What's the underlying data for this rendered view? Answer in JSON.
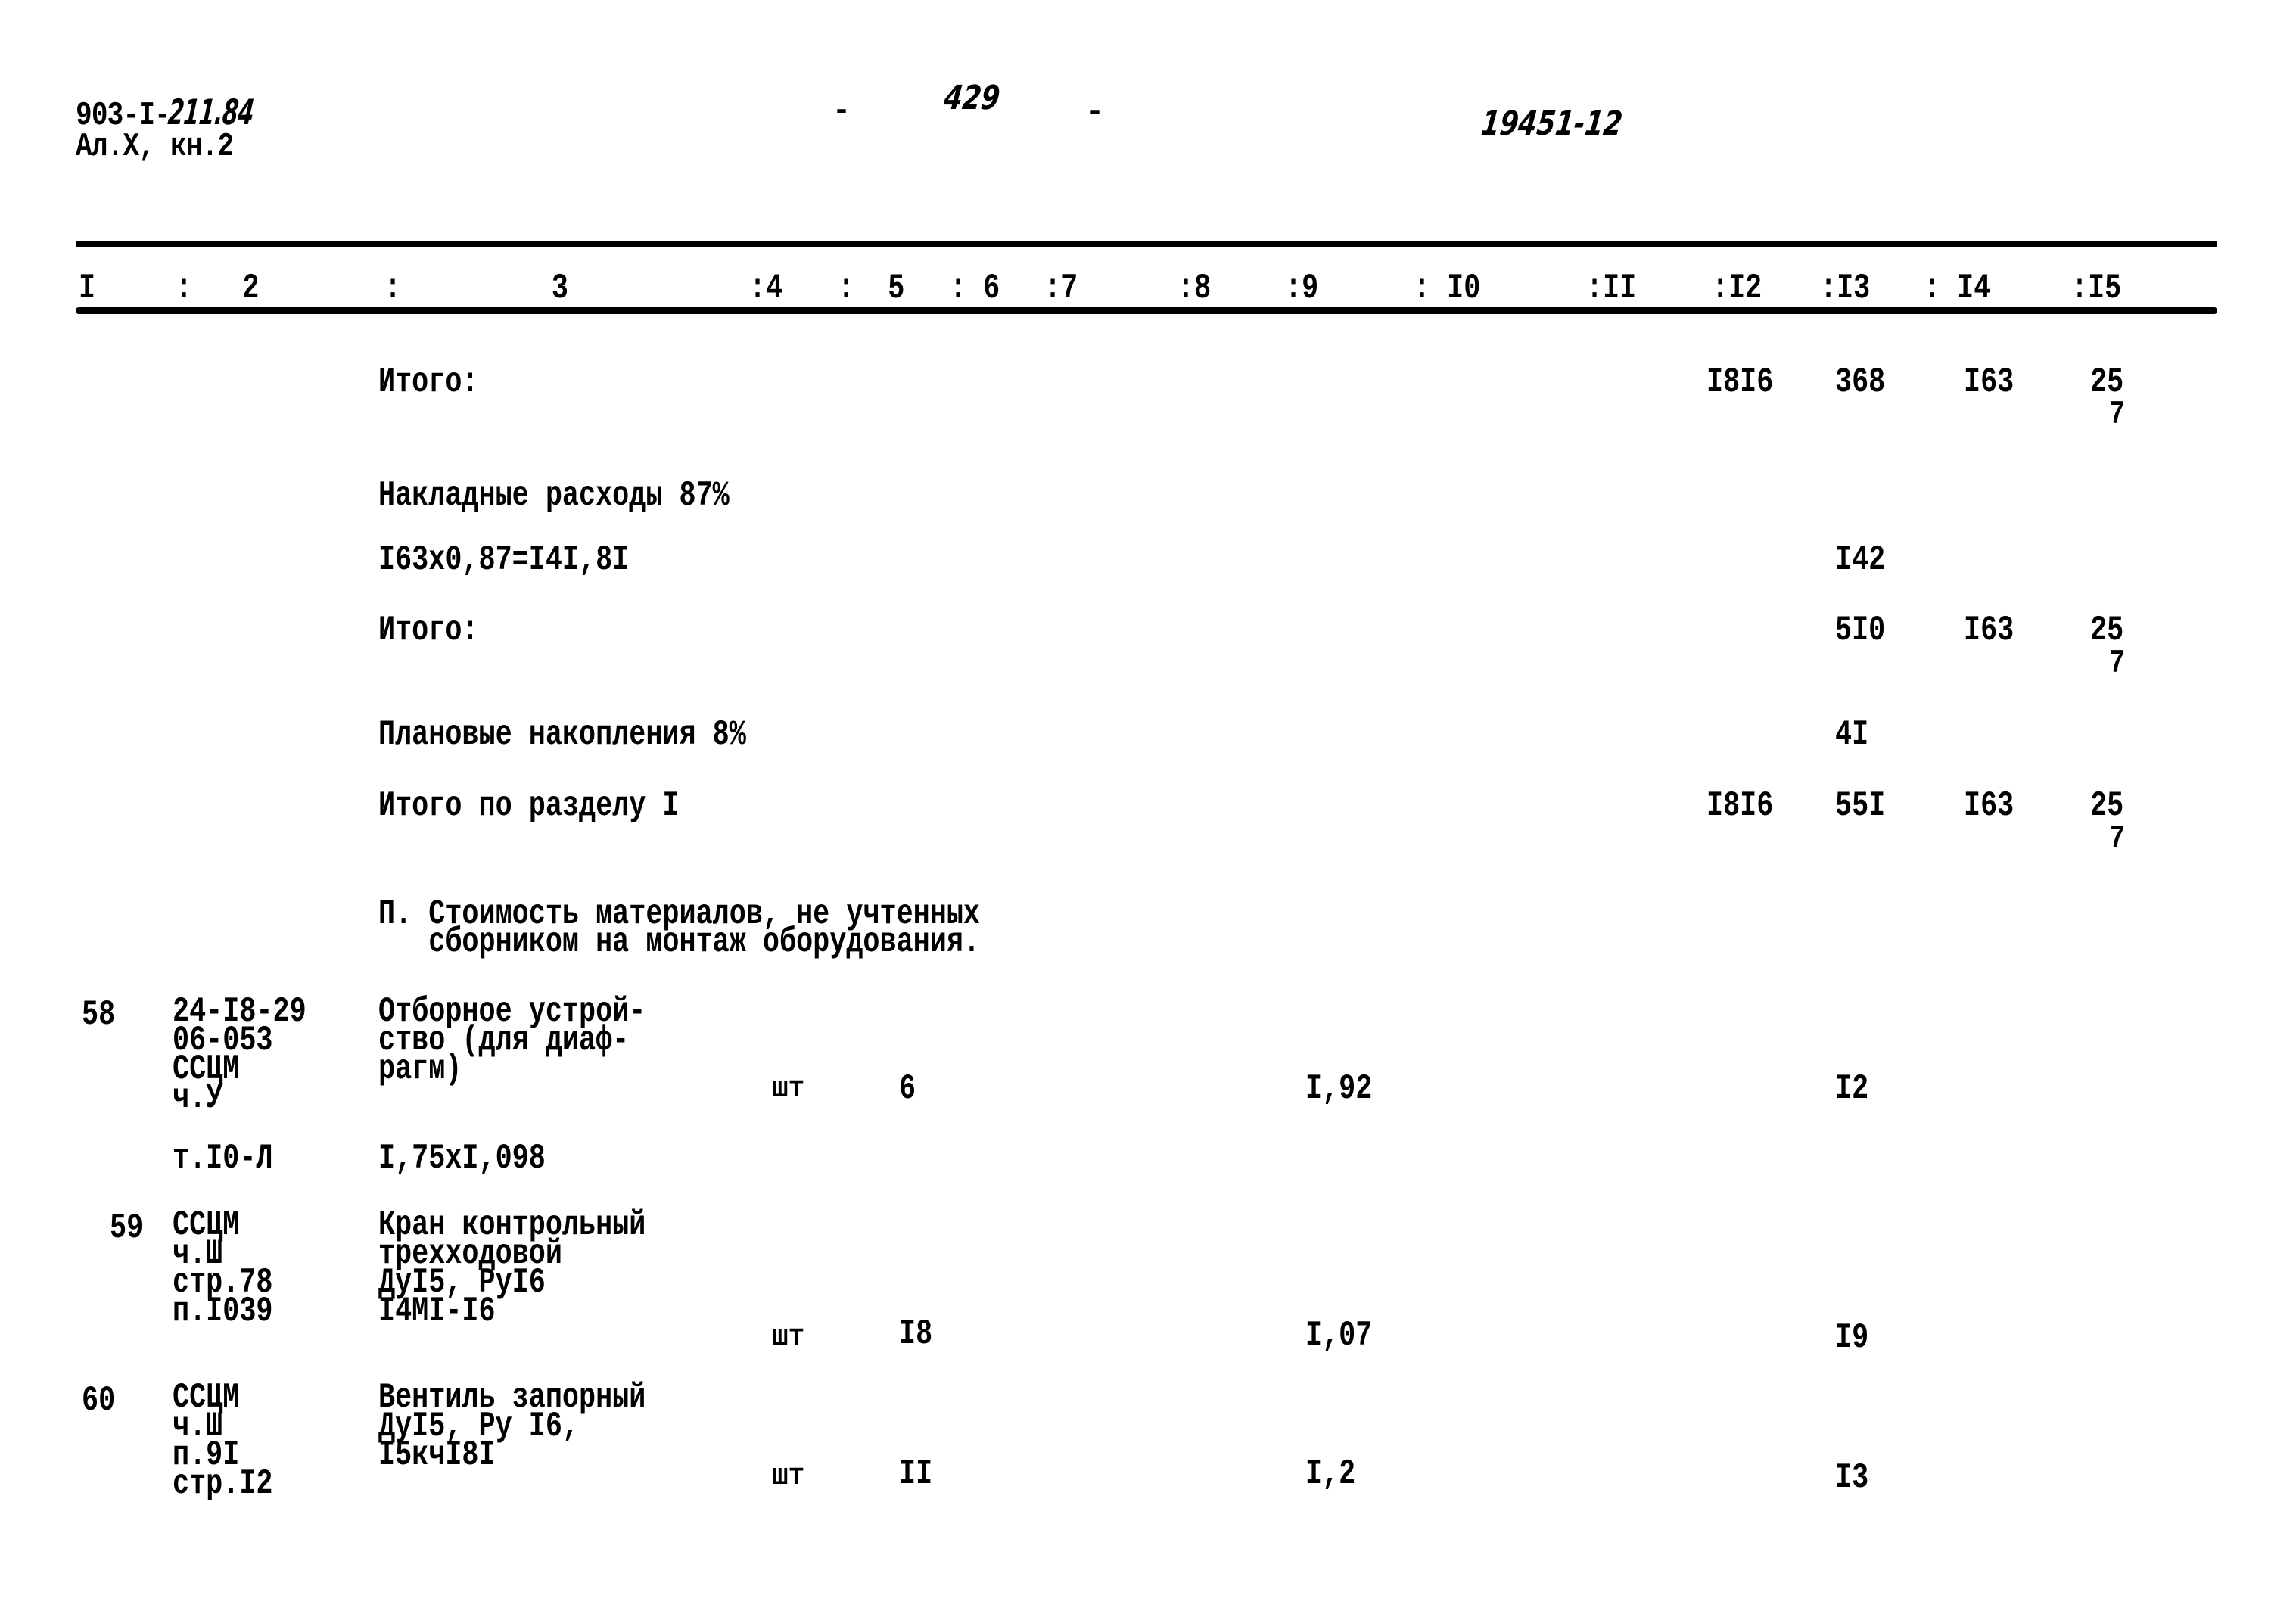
{
  "header": {
    "doc_code_prefix": "903-I-",
    "doc_code_handwritten": "211.84",
    "album_line": "Ал.X, кн.2",
    "page_number_dash_left": "-",
    "page_number": "429",
    "page_number_dash_right": "-",
    "inventory_number": "19451-12"
  },
  "columns": [
    {
      "label": "I",
      "sep": ""
    },
    {
      "label": "2",
      "sep": ":"
    },
    {
      "label": "3",
      "sep": ":"
    },
    {
      "label": "4",
      "sep": ":"
    },
    {
      "label": "5",
      "sep": ":"
    },
    {
      "label": "6",
      "sep": ":"
    },
    {
      "label": "7",
      "sep": ":"
    },
    {
      "label": "8",
      "sep": ":"
    },
    {
      "label": "9",
      "sep": ":"
    },
    {
      "label": "I0",
      "sep": ":"
    },
    {
      "label": "II",
      "sep": ":"
    },
    {
      "label": "I2",
      "sep": ":"
    },
    {
      "label": "I3",
      "sep": ":"
    },
    {
      "label": "I4",
      "sep": ":"
    },
    {
      "label": "I5",
      "sep": ":"
    }
  ],
  "summary": {
    "total1": {
      "label": "Итого:",
      "c12": "I8I6",
      "c13": "368",
      "c14": "I63",
      "c15_top": "25",
      "c15_bottom": "7"
    },
    "overhead": {
      "label": "Накладные расходы 87%",
      "calc": "I63x0,87=I4I,8I",
      "c13": "I42"
    },
    "total2": {
      "label": "Итого:",
      "c13": "5I0",
      "c14": "I63",
      "c15_top": "25",
      "c15_bottom": "7"
    },
    "planned": {
      "label": "Плановые накопления 8%",
      "c13": "4I"
    },
    "section_total": {
      "label": "Итого по разделу I",
      "c12": "I8I6",
      "c13": "55I",
      "c14": "I63",
      "c15_top": "25",
      "c15_bottom": "7"
    }
  },
  "section2": {
    "title_line1": "П. Стоимость материалов, не учтенных",
    "title_line2": "   сборником на монтаж оборудования."
  },
  "rows": [
    {
      "num": "58",
      "ref_lines": [
        "24-I8-29",
        "06-053",
        "ССЦМ",
        "ч.У",
        "т.I0-Л"
      ],
      "desc_lines": [
        "Отборное устрой-",
        "ство (для диаф-",
        "рагм)"
      ],
      "calc": "I,75xI,098",
      "unit": "шт",
      "qty": "6",
      "price": "I,92",
      "cost": "I2"
    },
    {
      "num": "59",
      "ref_lines": [
        "ССЦМ",
        "ч.Ш",
        "стр.78",
        "п.I039"
      ],
      "desc_lines": [
        "Кран контрольный",
        "трехходовой",
        "ДуI5, РуI6",
        "I4МI-I6"
      ],
      "calc": "",
      "unit": "шт",
      "qty": "I8",
      "price": "I,07",
      "cost": "I9"
    },
    {
      "num": "60",
      "ref_lines": [
        "ССЦМ",
        "ч.Ш",
        "п.9I",
        "стр.I2"
      ],
      "desc_lines": [
        "Вентиль запорный",
        "ДуI5, Ру I6,",
        "I5кчI8I"
      ],
      "calc": "",
      "unit": "шт",
      "qty": "II",
      "price": "I,2",
      "cost": "I3"
    }
  ]
}
